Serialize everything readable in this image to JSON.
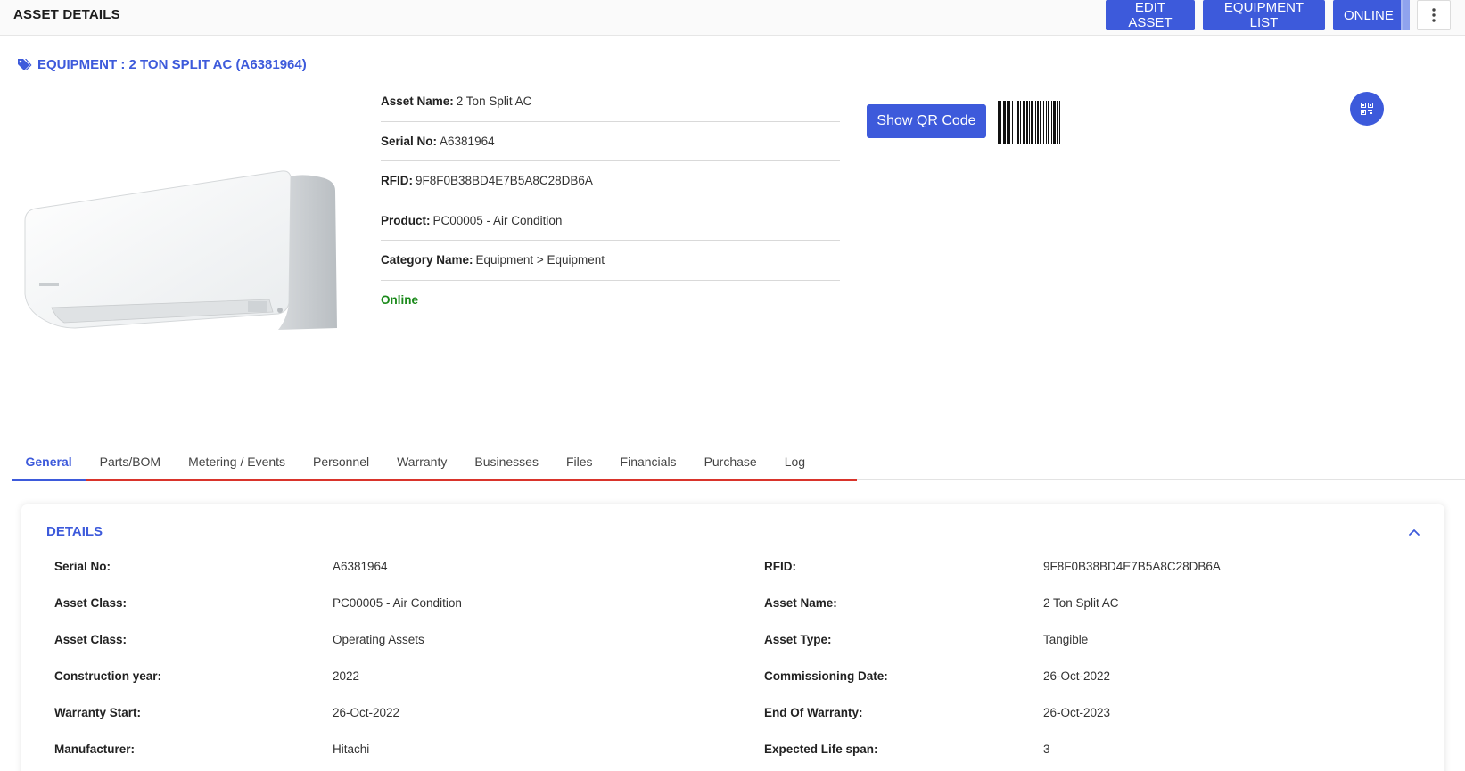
{
  "header": {
    "title": "ASSET DETAILS",
    "edit_label": "EDIT ASSET",
    "equipment_list_label": "EQUIPMENT LIST",
    "online_label": "ONLINE",
    "more_icon": "kebab-vertical-icon"
  },
  "equipment": {
    "heading": "EQUIPMENT : 2 TON SPLIT AC (A6381964)",
    "tag_icon": "tag-icon",
    "fields": [
      {
        "label": "Asset Name:",
        "value": "2 Ton Split AC"
      },
      {
        "label": "Serial No:",
        "value": "A6381964"
      },
      {
        "label": "RFID:",
        "value": "9F8F0B38BD4E7B5A8C28DB6A"
      },
      {
        "label": "Product:",
        "value": "PC00005 - Air Condition"
      },
      {
        "label": "Category Name:",
        "value": "Equipment > Equipment"
      }
    ],
    "status": "Online",
    "status_color": "#1b8a1b",
    "qr_button_label": "Show QR Code",
    "qr_icon": "qr-code-icon"
  },
  "tabs": [
    "General",
    "Parts/BOM",
    "Metering / Events",
    "Personnel",
    "Warranty",
    "Businesses",
    "Files",
    "Financials",
    "Purchase",
    "Log"
  ],
  "active_tab": "General",
  "details": {
    "title": "DETAILS",
    "collapse_icon": "chevron-up-icon",
    "rows": [
      {
        "l1": "Serial No:",
        "v1": "A6381964",
        "l2": "RFID:",
        "v2": "9F8F0B38BD4E7B5A8C28DB6A"
      },
      {
        "l1": "Asset Class:",
        "v1": "PC00005 - Air Condition",
        "l2": "Asset Name:",
        "v2": "2 Ton Split AC"
      },
      {
        "l1": "Asset Class:",
        "v1": "Operating Assets",
        "l2": "Asset Type:",
        "v2": "Tangible"
      },
      {
        "l1": "Construction year:",
        "v1": "2022",
        "l2": "Commissioning Date:",
        "v2": "26-Oct-2022"
      },
      {
        "l1": "Warranty Start:",
        "v1": "26-Oct-2022",
        "l2": "End Of Warranty:",
        "v2": "26-Oct-2023"
      },
      {
        "l1": "Manufacturer:",
        "v1": "Hitachi",
        "l2": "Expected Life span:",
        "v2": "3"
      }
    ]
  },
  "colors": {
    "accent": "#3d5adb",
    "tab_underline": "#d9342b",
    "online": "#1b8a1b"
  }
}
